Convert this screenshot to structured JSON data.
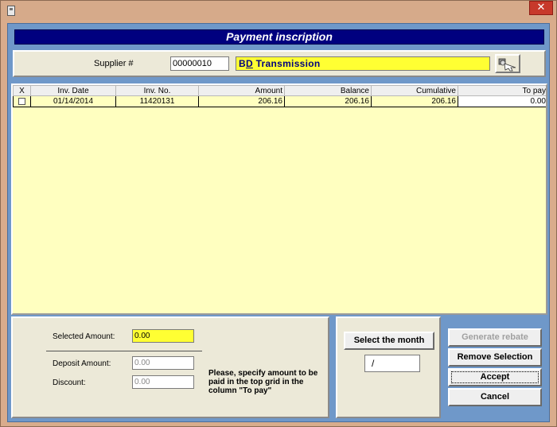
{
  "window": {
    "close_label": "✕"
  },
  "header": {
    "title": "Payment inscription"
  },
  "supplier": {
    "label": "Supplier #",
    "number": "00000010",
    "name_prefix": "B",
    "name_underlined": "D",
    "name_rest": " Transmission"
  },
  "grid": {
    "columns": [
      "X",
      "Inv. Date",
      "Inv. No.",
      "Amount",
      "Balance",
      "Cumulative",
      "To pay"
    ],
    "rows": [
      {
        "date": "01/14/2014",
        "inv_no": "11420131",
        "amount": "206.16",
        "balance": "206.16",
        "cumulative": "206.16",
        "to_pay": "0.00"
      }
    ]
  },
  "summary": {
    "selected_label": "Selected Amount:",
    "selected_value": "0.00",
    "deposit_label": "Deposit Amount:",
    "deposit_value": "0.00",
    "discount_label": "Discount:",
    "discount_value": "0.00",
    "note": "Please, specify amount to be paid in the top grid in the column \"To pay\""
  },
  "month": {
    "button_label": "Select the month",
    "value": "/"
  },
  "actions": {
    "generate_rebate": "Generate rebate",
    "remove_selection": "Remove Selection",
    "accept": "Accept",
    "cancel": "Cancel"
  },
  "colors": {
    "header_bg": "#00007f",
    "grid_bg": "#ffffc0",
    "highlight": "#ffff33",
    "client_bg": "#6f98c9"
  }
}
